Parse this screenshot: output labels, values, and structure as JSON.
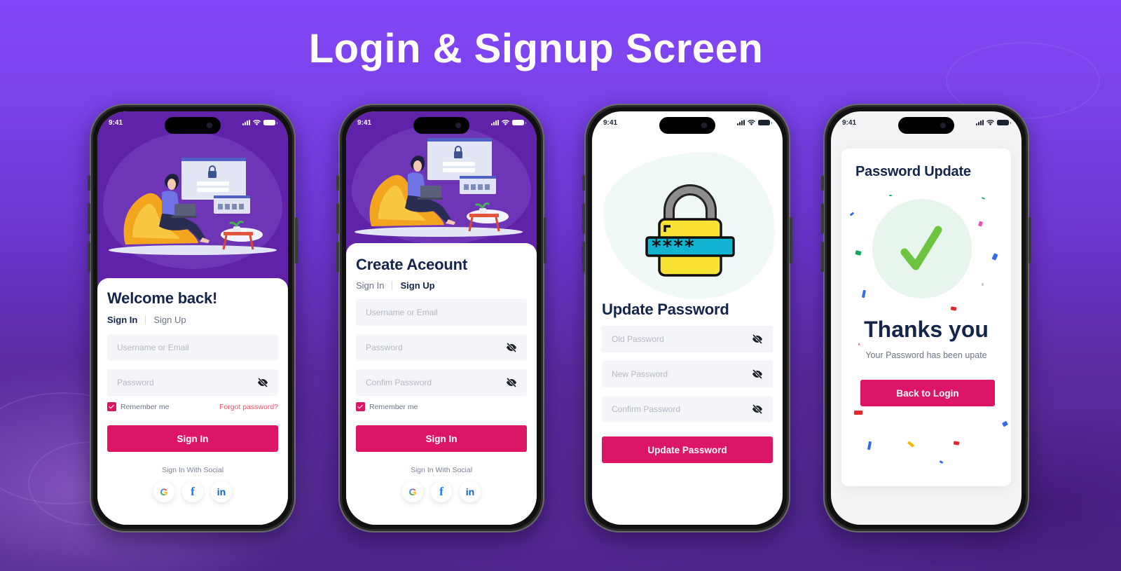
{
  "headline": "Login & Signup Screen",
  "colors": {
    "primary": "#dc1566",
    "heading": "#14254b",
    "hero_purple": "#5f22a8",
    "forgot_link": "#f2536b",
    "success_check": "#6cc43f"
  },
  "status_bar": {
    "time": "9:41"
  },
  "screens": {
    "sign_in": {
      "title": "Welcome back!",
      "tabs": [
        {
          "label": "Sign In",
          "active": true
        },
        {
          "label": "Sign Up",
          "active": false
        }
      ],
      "fields": {
        "username": {
          "placeholder": "Username or Email",
          "value": ""
        },
        "password": {
          "placeholder": "Password",
          "value": "",
          "icon": "eye-off-icon"
        }
      },
      "remember_label": "Remember me",
      "remember_checked": true,
      "forgot_label": "Forgot password?",
      "submit_label": "Sign In",
      "social_label": "Sign In With Social",
      "socials": [
        {
          "name": "google",
          "glyph": "G"
        },
        {
          "name": "facebook",
          "glyph": "f"
        },
        {
          "name": "linkedin",
          "glyph": "in"
        }
      ]
    },
    "sign_up": {
      "title": "Create Aceount",
      "tabs": [
        {
          "label": "Sign In",
          "active": false
        },
        {
          "label": "Sign Up",
          "active": true
        }
      ],
      "fields": {
        "username": {
          "placeholder": "Username or Email",
          "value": ""
        },
        "password": {
          "placeholder": "Password",
          "value": "",
          "icon": "eye-off-icon"
        },
        "confirm": {
          "placeholder": "Confim Password",
          "value": "",
          "icon": "eye-off-icon"
        }
      },
      "remember_label": "Remember me",
      "remember_checked": true,
      "submit_label": "Sign In",
      "social_label": "Sign In With Social",
      "socials": [
        {
          "name": "google",
          "glyph": "G"
        },
        {
          "name": "facebook",
          "glyph": "f"
        },
        {
          "name": "linkedin",
          "glyph": "in"
        }
      ]
    },
    "update_password": {
      "title": "Update Password",
      "lock_mask": "****_",
      "fields": {
        "old": {
          "placeholder": "Old Password",
          "value": ""
        },
        "new": {
          "placeholder": "New Password",
          "value": ""
        },
        "confirm": {
          "placeholder": "Confirm Password",
          "value": ""
        }
      },
      "submit_label": "Update Password"
    },
    "success": {
      "card_title": "Password Update",
      "heading": "Thanks you",
      "message": "Your Password has been upate",
      "button_label": "Back to Login"
    }
  }
}
